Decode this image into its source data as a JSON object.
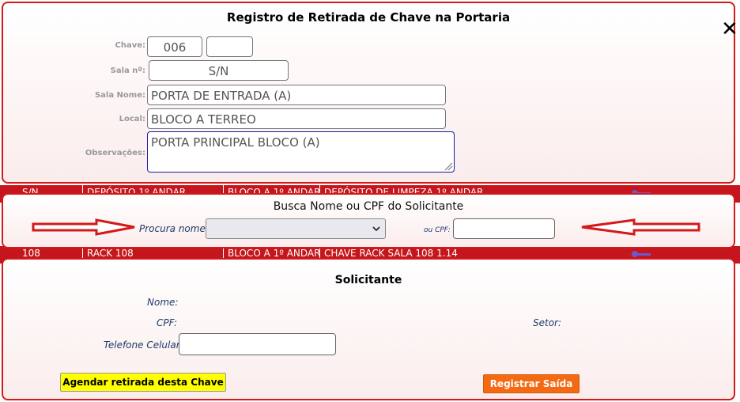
{
  "modal": {
    "title": "Registro de Retirada de Chave na Portaria",
    "close_glyph": "✕",
    "fields": {
      "chave_label": "Chave:",
      "chave_value": "006",
      "chave_extra_value": "",
      "sala_label": "Sala nº:",
      "sala_value": "S/N",
      "sala_nome_label": "Sala Nome:",
      "sala_nome_value": "PORTA DE ENTRADA (A)",
      "local_label": "Local:",
      "local_value": "BLOCO A TERREO",
      "obs_label": "Observações:",
      "obs_value": "PORTA PRINCIPAL BLOCO (A)"
    }
  },
  "background_rows": [
    {
      "c1": "S/N",
      "c2": "DEPÓSITO 1º ANDAR",
      "c3": "BLOCO A 1º ANDAR",
      "c4": "DEPÓSITO DE LIMPEZA 1º ANDAR"
    },
    {
      "c1": "108",
      "c2": "RACK 108",
      "c3": "BLOCO A 1º ANDAR",
      "c4": "CHAVE RACK SALA 108 1.14"
    }
  ],
  "search": {
    "title": "Busca Nome ou CPF do Solicitante",
    "name_label": "Procura nome:",
    "name_selected": "",
    "cpf_label": "ou CPF:",
    "cpf_value": ""
  },
  "requester": {
    "title": "Solicitante",
    "nome_label": "Nome:",
    "cpf_label": "CPF:",
    "setor_label": "Setor:",
    "phone_label": "Telefone Celular:",
    "phone_value": "",
    "schedule_button": "Agendar retirada desta Chave",
    "register_button": "Registrar Saída"
  },
  "colors": {
    "panel_border": "#d21a1a",
    "schedule_button": "#ffff00",
    "register_button": "#f36a12",
    "arrow": "#d21a1a"
  }
}
